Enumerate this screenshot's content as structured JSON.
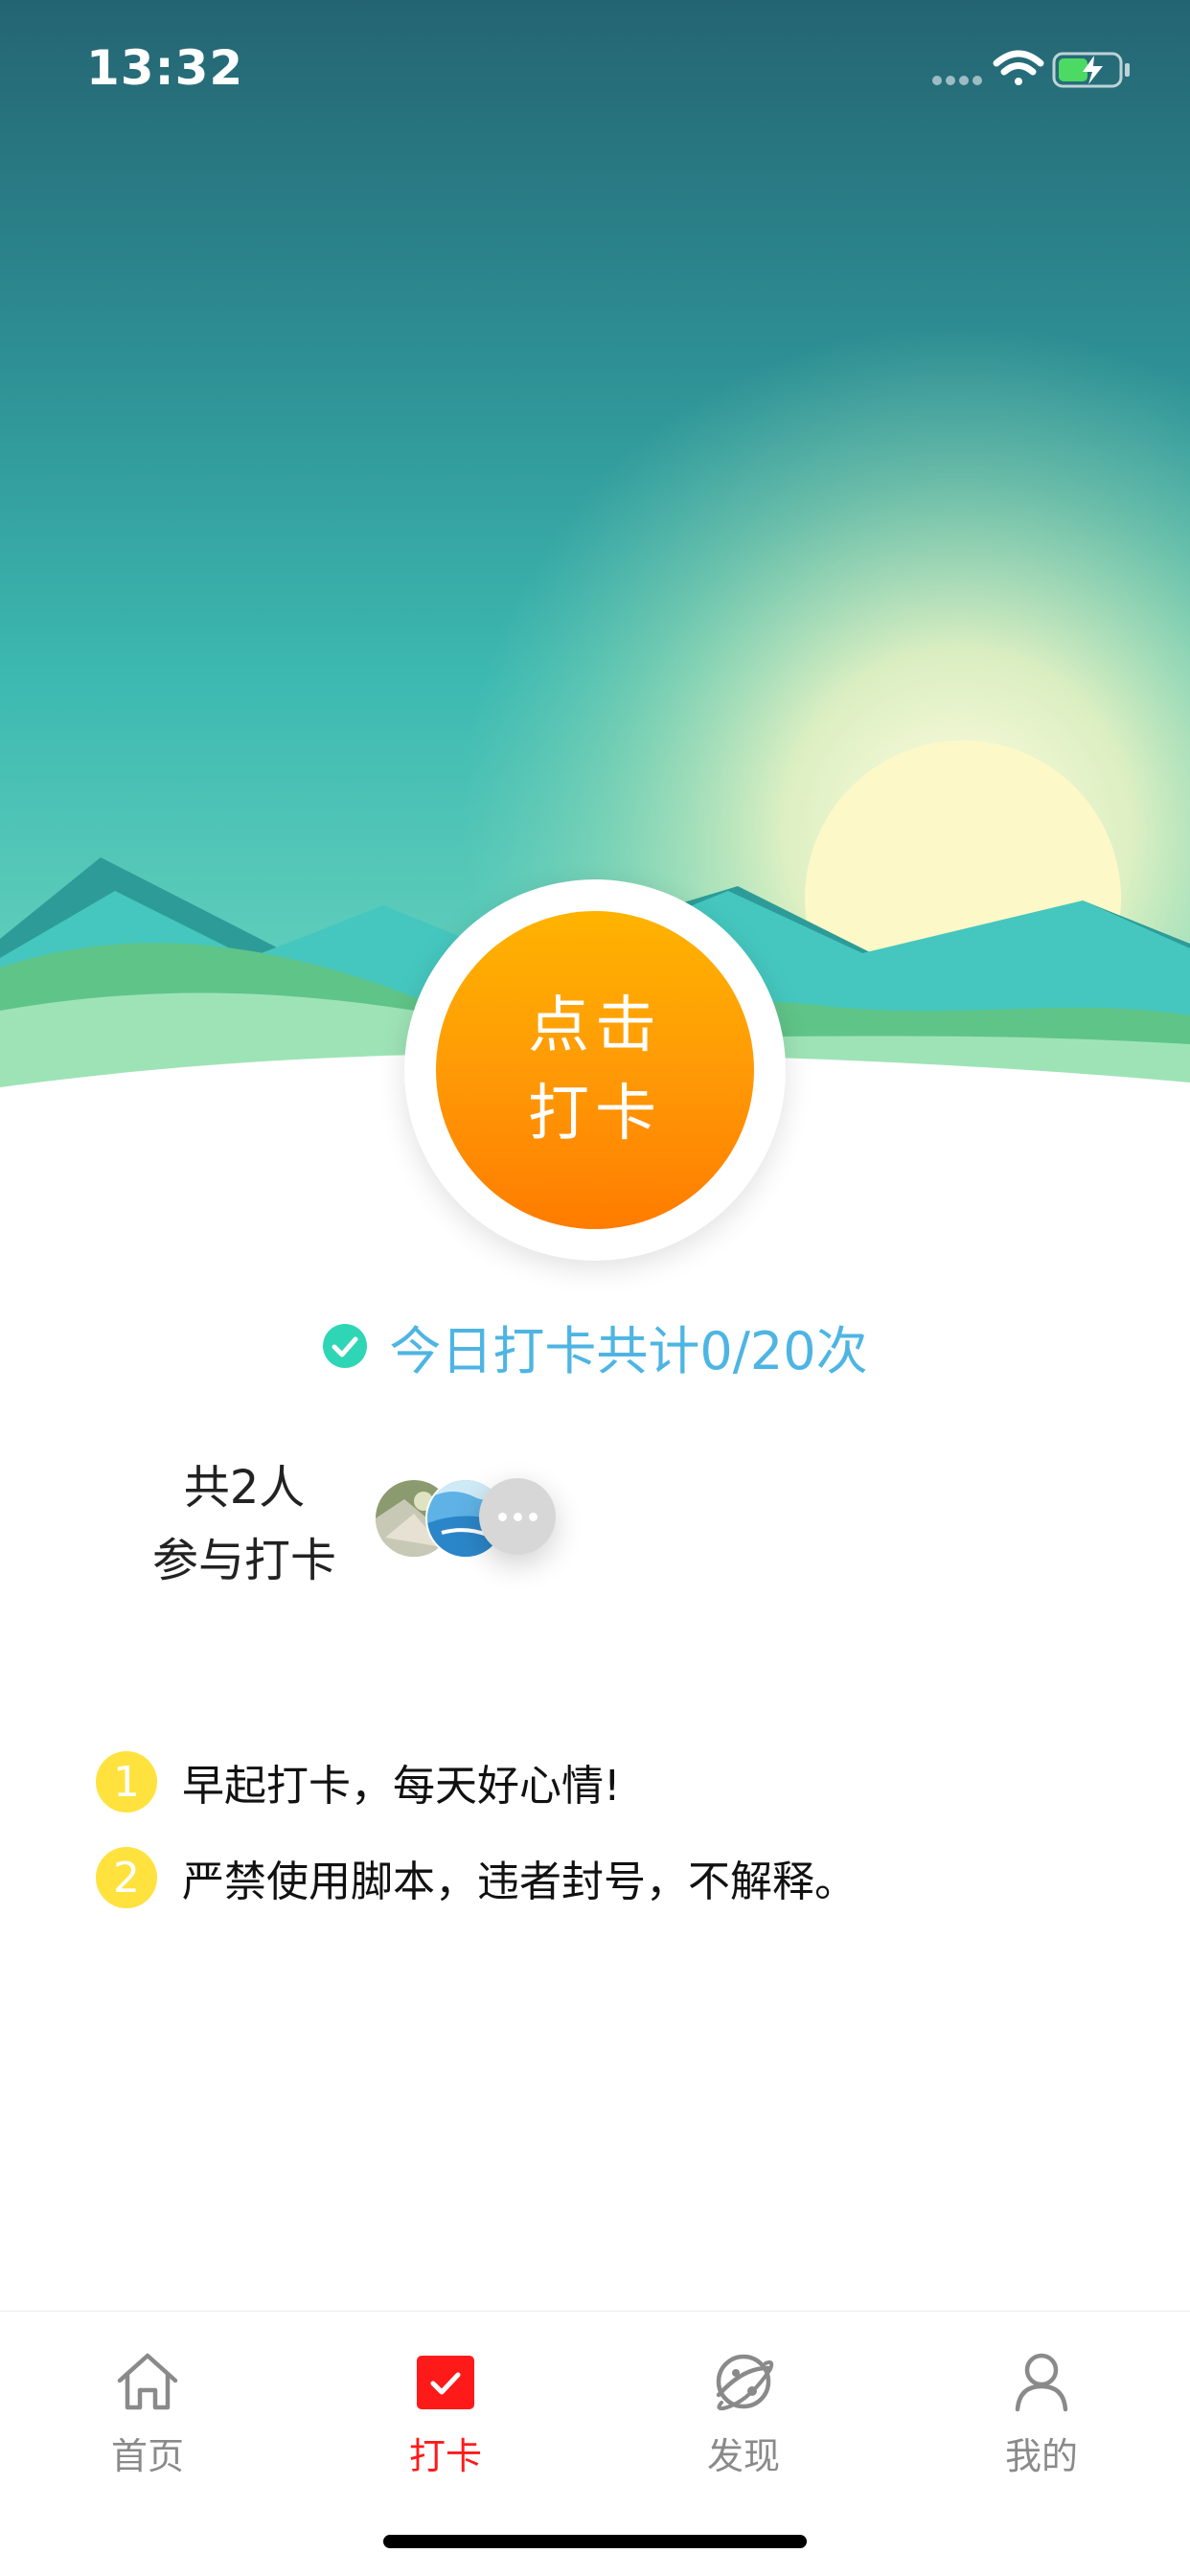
{
  "status_bar": {
    "time": "13:32"
  },
  "checkin": {
    "line1": "点击",
    "line2": "打卡"
  },
  "summary": {
    "count_text": "今日打卡共计0/20次"
  },
  "participants": {
    "line1": "共2人",
    "line2": "参与打卡"
  },
  "rules": [
    {
      "num": "1",
      "text": "早起打卡，每天好心情!"
    },
    {
      "num": "2",
      "text": "严禁使用脚本，违者封号，不解释。"
    }
  ],
  "tabbar": {
    "home": "首页",
    "checkin": "打卡",
    "discover": "发现",
    "mine": "我的"
  },
  "colors": {
    "accent_red": "#ff1a1a",
    "button_orange": "#ff9a06",
    "count_blue": "#4eb5e3",
    "check_green": "#2fd6b5",
    "rule_yellow": "#ffe23d"
  },
  "icons": [
    "cellular-icon",
    "wifi-icon",
    "battery-charging-icon",
    "check-circle-icon",
    "home-icon",
    "checkin-tab-icon",
    "planet-icon",
    "user-icon",
    "more-icon"
  ]
}
